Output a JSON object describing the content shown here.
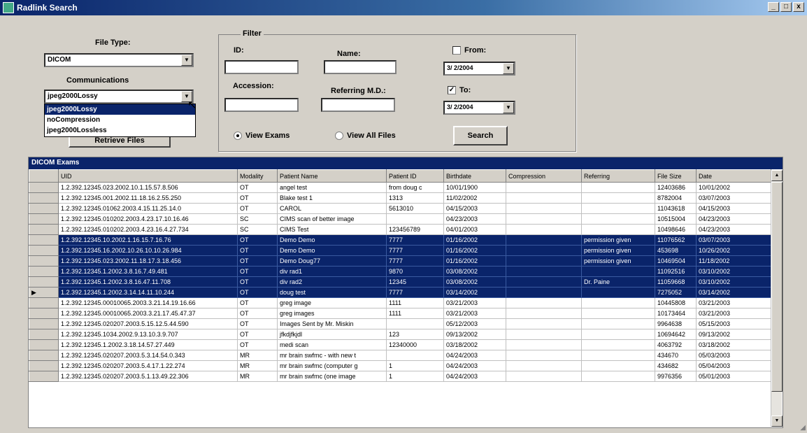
{
  "window": {
    "title": "Radlink Search",
    "min_label": "_",
    "max_label": "□",
    "close_label": "x"
  },
  "file_type": {
    "label": "File Type:",
    "value": "DICOM",
    "arrow": "▼"
  },
  "communications": {
    "label": "Communications",
    "value": "jpeg2000Lossy",
    "options": [
      "jpeg2000Lossy",
      "noCompression",
      "jpeg2000Lossless"
    ],
    "selected_index": 0
  },
  "retrieve_button": {
    "label": "Retrieve Files"
  },
  "filter": {
    "title": "Filter",
    "id_label": "ID:",
    "id_value": "",
    "name_label": "Name:",
    "name_value": "",
    "accession_label": "Accession:",
    "accession_value": "",
    "referring_label": "Referring M.D.:",
    "referring_value": "",
    "from_label": "From:",
    "from_checked": false,
    "from_date": "3/ 2/2004",
    "to_label": "To:",
    "to_checked": true,
    "to_date": "3/ 2/2004",
    "check_mark": "✓",
    "view_exams_label": "View Exams",
    "view_exams_selected": true,
    "view_all_label": "View All Files",
    "view_all_selected": false,
    "search_label": "Search"
  },
  "grid": {
    "caption": "DICOM Exams",
    "columns": [
      "UID",
      "Modality",
      "Patient Name",
      "Patient ID",
      "Birthdate",
      "Compression",
      "Referring",
      "File Size",
      "Date"
    ],
    "current_marker": "▶",
    "rows": [
      {
        "uid": "1.2.392.12345.023.2002.10.1.15.57.8.506",
        "modality": "OT",
        "patient": "angel test",
        "pid": "from doug c",
        "birth": "10/01/1900",
        "comp": "",
        "ref": "",
        "size": "12403686",
        "date": "10/01/2002",
        "sel": false,
        "cur": false
      },
      {
        "uid": "1.2.392.12345.001.2002.11.18.16.2.55.250",
        "modality": "OT",
        "patient": "Blake test 1",
        "pid": "1313",
        "birth": "11/02/2002",
        "comp": "",
        "ref": "",
        "size": "8782004",
        "date": "03/07/2003",
        "sel": false,
        "cur": false
      },
      {
        "uid": "1.2.392.12345.01062.2003.4.15.11.25.14.0",
        "modality": "OT",
        "patient": "CAROL",
        "pid": "5613010",
        "birth": "04/15/2003",
        "comp": "",
        "ref": "",
        "size": "11043618",
        "date": "04/15/2003",
        "sel": false,
        "cur": false
      },
      {
        "uid": "1.2.392.12345.010202.2003.4.23.17.10.16.46",
        "modality": "SC",
        "patient": "CIMS scan of better image",
        "pid": "",
        "birth": "04/23/2003",
        "comp": "",
        "ref": "",
        "size": "10515004",
        "date": "04/23/2003",
        "sel": false,
        "cur": false
      },
      {
        "uid": "1.2.392.12345.010202.2003.4.23.16.4.27.734",
        "modality": "SC",
        "patient": "CIMS Test",
        "pid": "123456789",
        "birth": "04/01/2003",
        "comp": "",
        "ref": "",
        "size": "10498646",
        "date": "04/23/2003",
        "sel": false,
        "cur": false
      },
      {
        "uid": "1.2.392.12345.10.2002.1.16.15.7.16.76",
        "modality": "OT",
        "patient": "Demo Demo",
        "pid": "7777",
        "birth": "01/16/2002",
        "comp": "",
        "ref": "permission given",
        "size": "11076562",
        "date": "03/07/2003",
        "sel": true,
        "cur": false
      },
      {
        "uid": "1.2.392.12345.16.2002.10.26.10.10.26.984",
        "modality": "OT",
        "patient": "Demo Demo",
        "pid": "7777",
        "birth": "01/16/2002",
        "comp": "",
        "ref": "permission given",
        "size": "453698",
        "date": "10/26/2002",
        "sel": true,
        "cur": false
      },
      {
        "uid": "1.2.392.12345.023.2002.11.18.17.3.18.456",
        "modality": "OT",
        "patient": "Demo Doug77",
        "pid": "7777",
        "birth": "01/16/2002",
        "comp": "",
        "ref": "permission given",
        "size": "10469504",
        "date": "11/18/2002",
        "sel": true,
        "cur": false
      },
      {
        "uid": "1.2.392.12345.1.2002.3.8.16.7.49.481",
        "modality": "OT",
        "patient": "div rad1",
        "pid": "9870",
        "birth": "03/08/2002",
        "comp": "",
        "ref": "",
        "size": "11092516",
        "date": "03/10/2002",
        "sel": true,
        "cur": false
      },
      {
        "uid": "1.2.392.12345.1.2002.3.8.16.47.11.708",
        "modality": "OT",
        "patient": "div rad2",
        "pid": "12345",
        "birth": "03/08/2002",
        "comp": "",
        "ref": "Dr. Paine",
        "size": "11059668",
        "date": "03/10/2002",
        "sel": true,
        "cur": false
      },
      {
        "uid": "1.2.392.12345.1.2002.3.14.14.11.10.244",
        "modality": "OT",
        "patient": "doug test",
        "pid": "7777",
        "birth": "03/14/2002",
        "comp": "",
        "ref": "",
        "size": "7275052",
        "date": "03/14/2002",
        "sel": true,
        "cur": true
      },
      {
        "uid": "1.2.392.12345.00010065.2003.3.21.14.19.16.66",
        "modality": "OT",
        "patient": "greg image",
        "pid": "1111",
        "birth": "03/21/2003",
        "comp": "",
        "ref": "",
        "size": "10445808",
        "date": "03/21/2003",
        "sel": false,
        "cur": false
      },
      {
        "uid": "1.2.392.12345.00010065.2003.3.21.17.45.47.37",
        "modality": "OT",
        "patient": "greg images",
        "pid": "1111",
        "birth": "03/21/2003",
        "comp": "",
        "ref": "",
        "size": "10173464",
        "date": "03/21/2003",
        "sel": false,
        "cur": false
      },
      {
        "uid": "1.2.392.12345.020207.2003.5.15.12.5.44.590",
        "modality": "OT",
        "patient": "Images Sent by Mr. Miskin",
        "pid": "",
        "birth": "05/12/2003",
        "comp": "",
        "ref": "",
        "size": "9964638",
        "date": "05/15/2003",
        "sel": false,
        "cur": false
      },
      {
        "uid": "1.2.392.12345.1034.2002.9.13.10.3.9.707",
        "modality": "OT",
        "patient": "jfkdjfkjdl",
        "pid": "123",
        "birth": "09/13/2002",
        "comp": "",
        "ref": "",
        "size": "10694642",
        "date": "09/13/2002",
        "sel": false,
        "cur": false
      },
      {
        "uid": "1.2.392.12345.1.2002.3.18.14.57.27.449",
        "modality": "OT",
        "patient": "medi scan",
        "pid": "12340000",
        "birth": "03/18/2002",
        "comp": "",
        "ref": "",
        "size": "4063792",
        "date": "03/18/2002",
        "sel": false,
        "cur": false
      },
      {
        "uid": "1.2.392.12345.020207.2003.5.3.14.54.0.343",
        "modality": "MR",
        "patient": "mr brain swfmc - with new t",
        "pid": "",
        "birth": "04/24/2003",
        "comp": "",
        "ref": "",
        "size": "434670",
        "date": "05/03/2003",
        "sel": false,
        "cur": false
      },
      {
        "uid": "1.2.392.12345.020207.2003.5.4.17.1.22.274",
        "modality": "MR",
        "patient": "mr brain swfmc (computer g",
        "pid": "1",
        "birth": "04/24/2003",
        "comp": "",
        "ref": "",
        "size": "434682",
        "date": "05/04/2003",
        "sel": false,
        "cur": false
      },
      {
        "uid": "1.2.392.12345.020207.2003.5.1.13.49.22.306",
        "modality": "MR",
        "patient": "mr brain swfmc (one image",
        "pid": "1",
        "birth": "04/24/2003",
        "comp": "",
        "ref": "",
        "size": "9976356",
        "date": "05/01/2003",
        "sel": false,
        "cur": false
      }
    ]
  },
  "scrollbar": {
    "up_arrow": "▲",
    "down_arrow": "▼"
  }
}
